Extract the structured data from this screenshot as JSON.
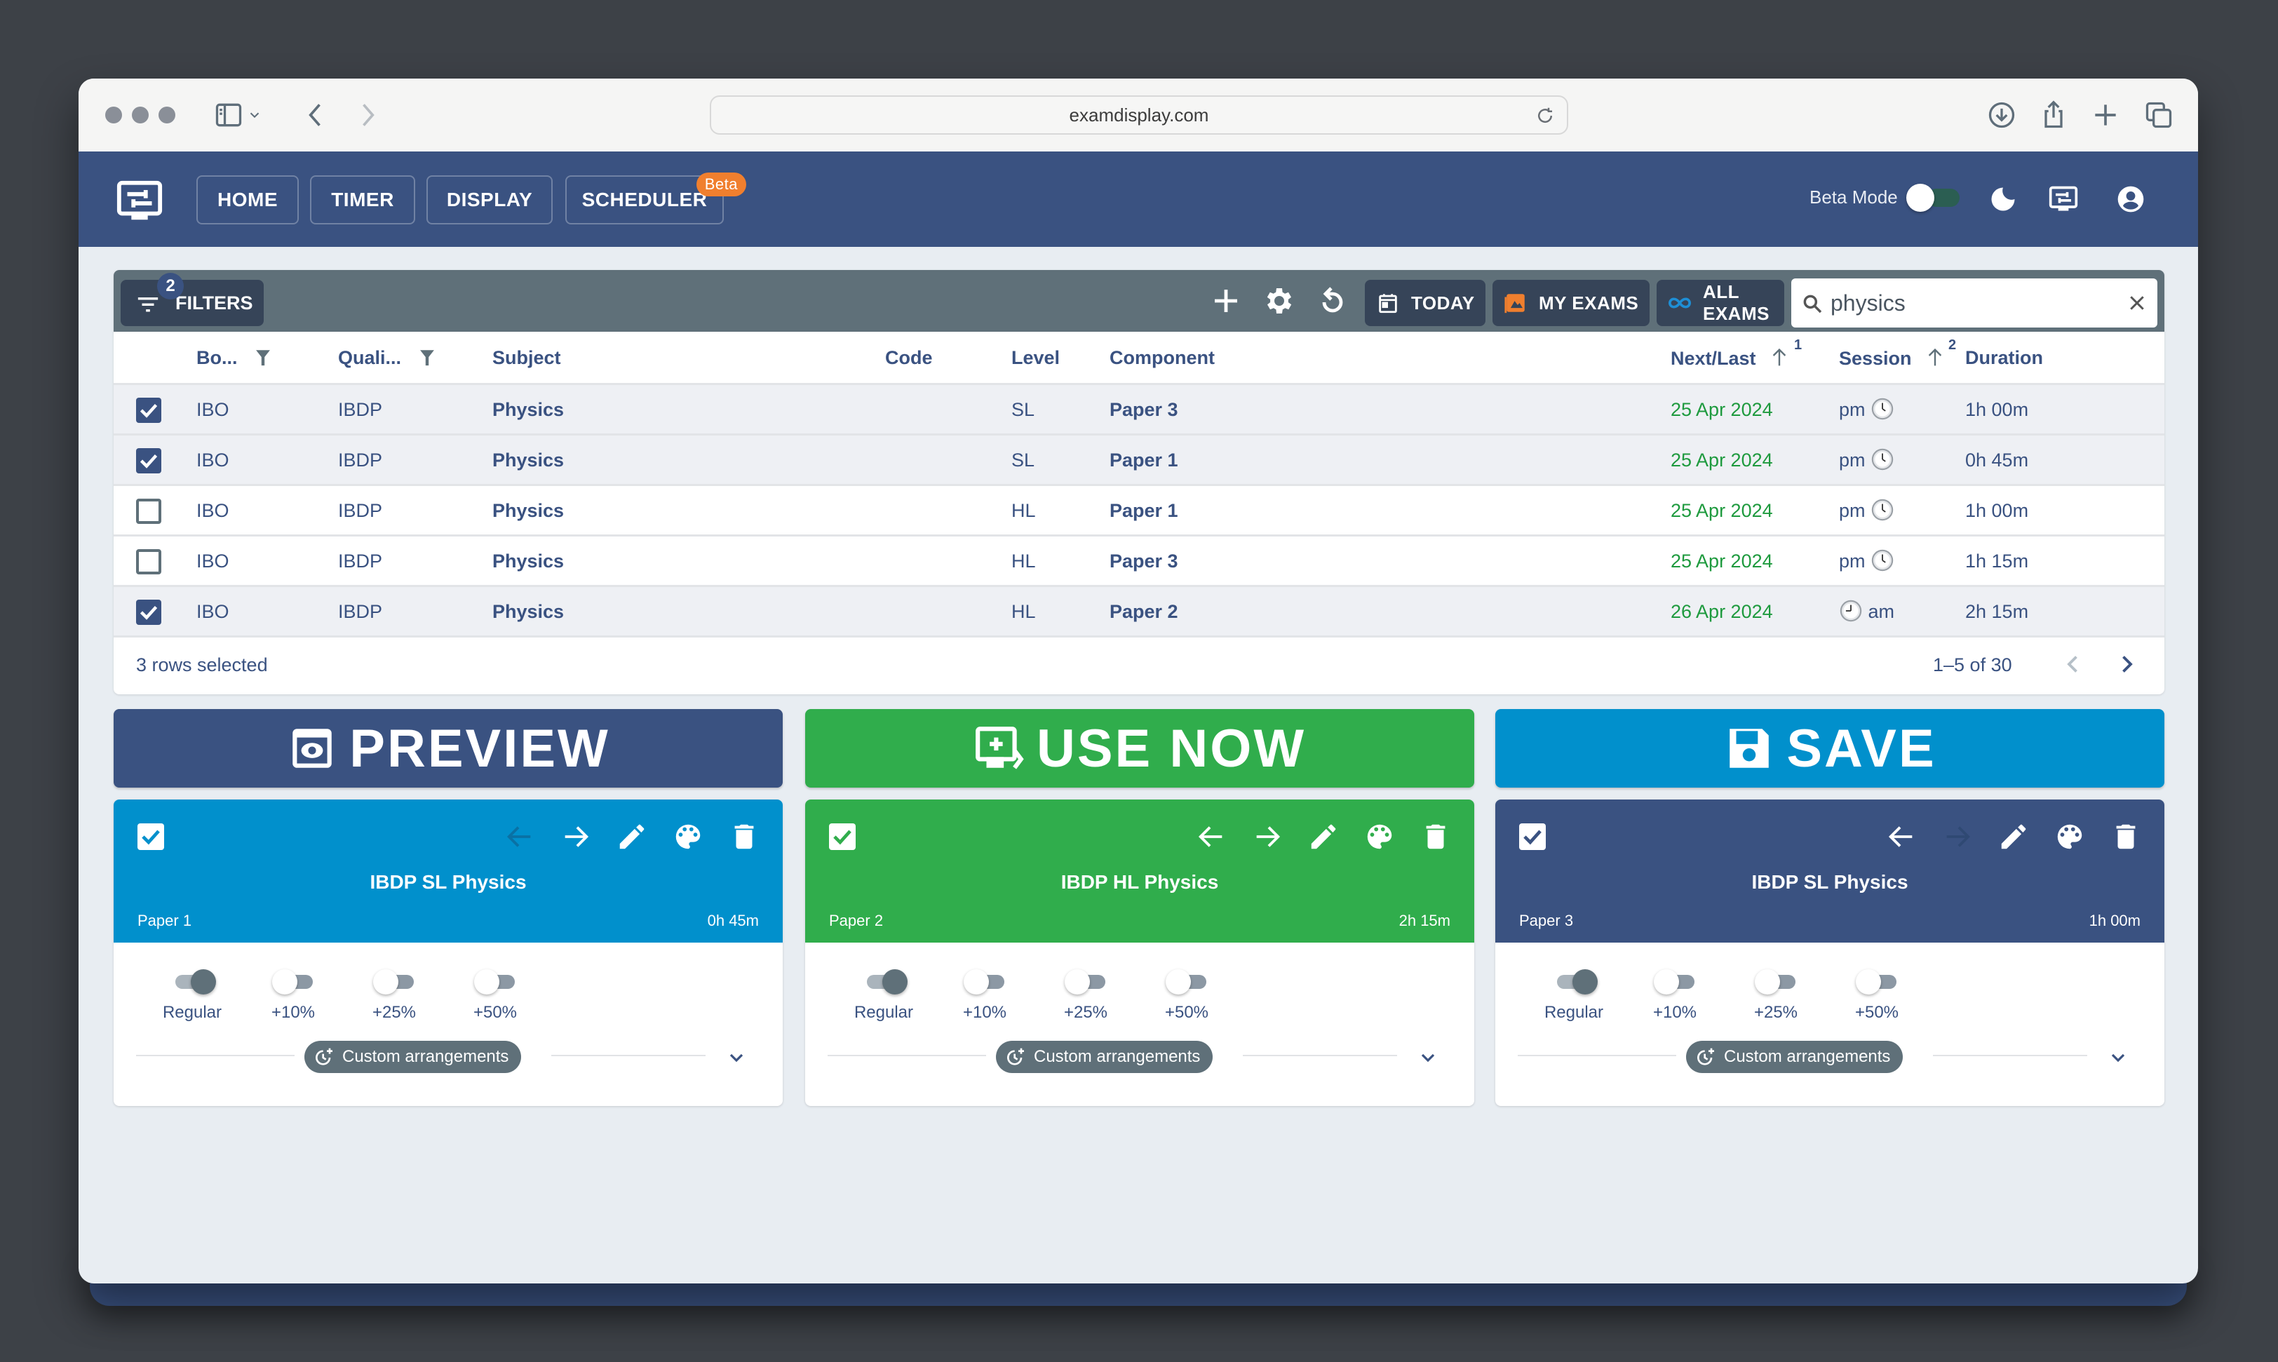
{
  "browser": {
    "url": "examdisplay.com"
  },
  "appbar": {
    "nav": [
      {
        "label": "HOME"
      },
      {
        "label": "TIMER"
      },
      {
        "label": "DISPLAY"
      },
      {
        "label": "SCHEDULER",
        "badge": "Beta"
      }
    ],
    "beta_mode_label": "Beta Mode",
    "beta_mode_on": false
  },
  "toolbar": {
    "filters_label": "FILTERS",
    "filters_count": "2",
    "today_label": "TODAY",
    "my_exams_label": "MY EXAMS",
    "all_exams_label": "ALL EXAMS",
    "search_value": "physics",
    "colors": {
      "my_exams_icon": "#f07f2e",
      "all_exams_icon": "#1e8fd6"
    }
  },
  "table": {
    "columns": [
      {
        "label": "Bo...",
        "filter": true
      },
      {
        "label": "Quali...",
        "filter": true
      },
      {
        "label": "Subject"
      },
      {
        "label": "Code"
      },
      {
        "label": "Level"
      },
      {
        "label": "Component"
      },
      {
        "label": "Next/Last",
        "sort": "asc",
        "sort_index": "1"
      },
      {
        "label": "Session",
        "sort": "asc",
        "sort_index": "2"
      },
      {
        "label": "Duration"
      }
    ],
    "rows": [
      {
        "selected": true,
        "board": "IBO",
        "qual": "IBDP",
        "subject": "Physics",
        "code": "",
        "level": "SL",
        "component": "Paper 3",
        "date": "25 Apr 2024",
        "session": "pm",
        "duration": "1h 00m"
      },
      {
        "selected": true,
        "board": "IBO",
        "qual": "IBDP",
        "subject": "Physics",
        "code": "",
        "level": "SL",
        "component": "Paper 1",
        "date": "25 Apr 2024",
        "session": "pm",
        "duration": "0h 45m"
      },
      {
        "selected": false,
        "board": "IBO",
        "qual": "IBDP",
        "subject": "Physics",
        "code": "",
        "level": "HL",
        "component": "Paper 1",
        "date": "25 Apr 2024",
        "session": "pm",
        "duration": "1h 00m"
      },
      {
        "selected": false,
        "board": "IBO",
        "qual": "IBDP",
        "subject": "Physics",
        "code": "",
        "level": "HL",
        "component": "Paper 3",
        "date": "25 Apr 2024",
        "session": "pm",
        "duration": "1h 15m"
      },
      {
        "selected": true,
        "board": "IBO",
        "qual": "IBDP",
        "subject": "Physics",
        "code": "",
        "level": "HL",
        "component": "Paper 2",
        "date": "26 Apr 2024",
        "session": "am",
        "duration": "2h 15m"
      }
    ],
    "footer": {
      "selected_text": "3 rows selected",
      "range_text": "1–5 of 30"
    }
  },
  "actions": {
    "preview_label": "PREVIEW",
    "use_now_label": "USE NOW",
    "save_label": "SAVE",
    "colors": {
      "preview": "#3a5281",
      "use_now": "#30ad4c",
      "save": "#0190cc"
    }
  },
  "cards": [
    {
      "title": "IBDP SL Physics",
      "component": "Paper 1",
      "duration": "0h 45m",
      "color": "#0190cc",
      "prev_disabled": true,
      "next_disabled": false
    },
    {
      "title": "IBDP HL Physics",
      "component": "Paper 2",
      "duration": "2h 15m",
      "color": "#30ad4c",
      "prev_disabled": false,
      "next_disabled": false
    },
    {
      "title": "IBDP SL Physics",
      "component": "Paper 3",
      "duration": "1h 00m",
      "color": "#3a5281",
      "prev_disabled": false,
      "next_disabled": true
    }
  ],
  "card_common": {
    "toggles": [
      {
        "label": "Regular",
        "on": true
      },
      {
        "label": "+10%",
        "on": false
      },
      {
        "label": "+25%",
        "on": false
      },
      {
        "label": "+50%",
        "on": false
      }
    ],
    "custom_label": "Custom arrangements"
  }
}
